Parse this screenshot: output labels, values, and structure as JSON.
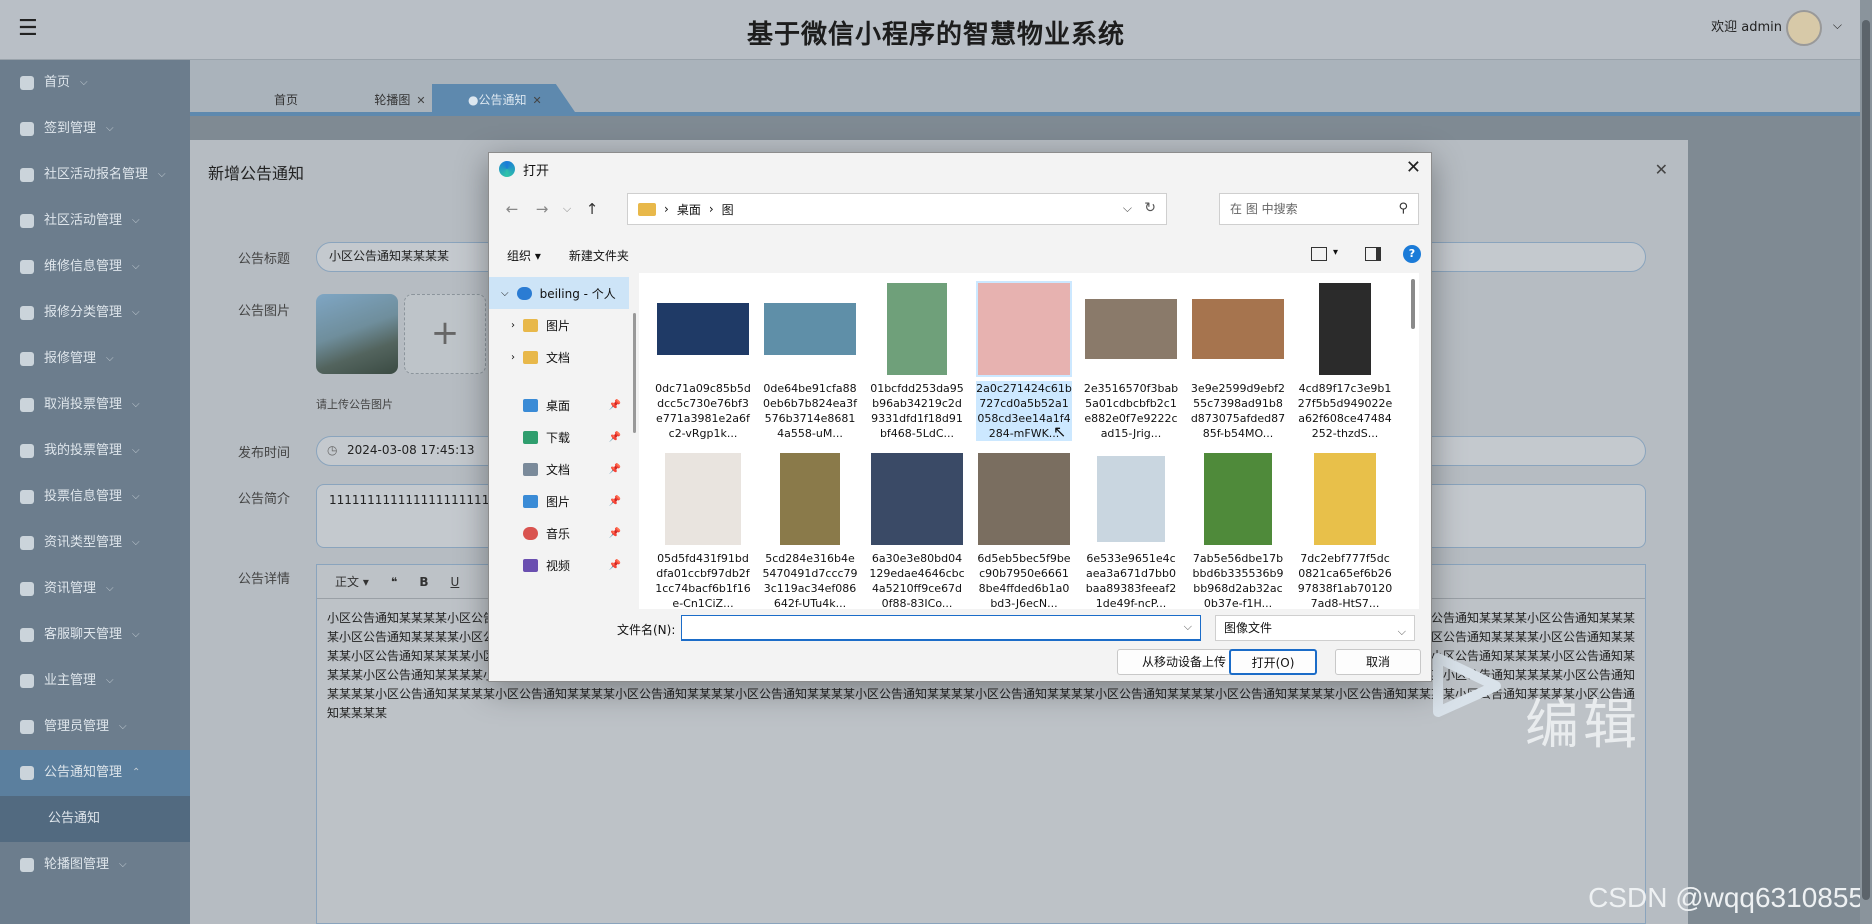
{
  "header": {
    "title": "基于微信小程序的智慧物业系统",
    "welcome": "欢迎 admin"
  },
  "sidebar": {
    "items": [
      {
        "label": "首页"
      },
      {
        "label": "签到管理"
      },
      {
        "label": "社区活动报名管理"
      },
      {
        "label": "社区活动管理"
      },
      {
        "label": "维修信息管理"
      },
      {
        "label": "报修分类管理"
      },
      {
        "label": "报修管理"
      },
      {
        "label": "取消投票管理"
      },
      {
        "label": "我的投票管理"
      },
      {
        "label": "投票信息管理"
      },
      {
        "label": "资讯类型管理"
      },
      {
        "label": "资讯管理"
      },
      {
        "label": "客服聊天管理"
      },
      {
        "label": "业主管理"
      },
      {
        "label": "管理员管理"
      },
      {
        "label": "公告通知管理"
      },
      {
        "label": "公告通知"
      },
      {
        "label": "轮播图管理"
      }
    ]
  },
  "tabs": [
    {
      "label": "首页"
    },
    {
      "label": "轮播图"
    },
    {
      "label": "●公告通知"
    }
  ],
  "dialog": {
    "title": "新增公告通知",
    "labels": {
      "title": "公告标题",
      "image": "公告图片",
      "time": "发布时间",
      "intro": "公告简介",
      "detail": "公告详情"
    },
    "title_value": "小区公告通知某某某某",
    "upload_hint": "请上传公告图片",
    "time_value": "2024-03-08 17:45:13",
    "intro_value": "1111111111111111111111111",
    "editor_toolbar": {
      "format": "正文",
      "quote": "❝",
      "bold": "B",
      "underline": "U"
    },
    "editor_text": "小区公告通知某某某某小区公告通知某某某某小区公告通知某某某某小区公告通知某某某某小区公告通知某某某某小区公告通知某某某某小区公告通知某某某某小区公告通知某某某某小区公告通知某某某某小区公告通知某某某某小区公告通知某某某某小区公告通知某某某某小区公告通知某某某某小区公告通知某某某某小区公告通知某某某某小区公告通知某某某某小区公告通知某某某某小区公告通知某某某某小区公告通知某某某某小区公告通知某某某某小区公告通知某某某某小区公告通知某某某某小区公告通知某某某某小区公告通知某某某某小区公告通知某某某某小区公告通知某某某某小区公告通知某某某某小区公告通知某某某某小区公告通知某某某某小区公告通知某某某某小区公告通知某某某某小区公告通知某某某某小区公告通知某某某某小区公告通知某某某某小区公告通知某某某某小区公告通知某某某某小区公告通知某某某某小区公告通知某某某某小区公告通知某某某某小区公告通知某某某某小区公告通知某某某某小区公告通知某某某某小区公告通知某某某某小区公告通知某某某某小区公告通知某某某某小区公告通知某某某某小区公告通知某某某某小区公告通知某某某某小区公告通知某某某某小区公告通知某某某某小区公告通知某某某某小区公告通知某某某某小区公告通知某某某某小区公告通知某某某某小区公告通知某某某某"
  },
  "watermark": {
    "brand_text": "编辑",
    "csdn": "CSDN @wqq6310855"
  },
  "file_dialog": {
    "title": "打开",
    "path": [
      "桌面",
      "图"
    ],
    "search_placeholder": "在 图 中搜索",
    "organize": "组织 ▾",
    "new_folder": "新建文件夹",
    "tree": [
      {
        "label": "beiling - 个人"
      },
      {
        "label": "图片"
      },
      {
        "label": "文档"
      },
      {
        "label": "桌面"
      },
      {
        "label": "下载"
      },
      {
        "label": "文档"
      },
      {
        "label": "图片"
      },
      {
        "label": "音乐"
      },
      {
        "label": "视频"
      }
    ],
    "files": [
      {
        "name": "0dc71a09c85b5ddcc5c730e76bf3e771a3981e2a6fc2-vRgp1k...",
        "color": "#1f3a66"
      },
      {
        "name": "0de64be91cfa880eb6b7b824ea3f576b3714e86814a558-uM...",
        "color": "#5f8fa8"
      },
      {
        "name": "01bcfdd253da95b96ab34219c2d9331dfd1f18d91bf468-5LdC...",
        "color": "#6fa07a"
      },
      {
        "name": "2a0c271424c61b727cd0a5b52a1058cd3ee14a1f4284-mFWK...",
        "color": "#e7b2b0"
      },
      {
        "name": "2e3516570f3bab5a01cdbcbfb2c1e882e0f7e9222cad15-Jrig...",
        "color": "#8a7a6a"
      },
      {
        "name": "3e9e2599d9ebf255c7398ad91b8d873075afded8785f-b54MO...",
        "color": "#a6744e"
      },
      {
        "name": "4cd89f17c3e9b127f5b5d949022ea62f608ce47484252-thzdS...",
        "color": "#2b2b2b"
      },
      {
        "name": "05d5fd431f91bddfa01ccbf97db2f1cc74bacf6b1f16e-Cn1CiZ...",
        "color": "#e9e4df"
      },
      {
        "name": "5cd284e316b4e5470491d7ccc793c119ac34ef086642f-UTu4k...",
        "color": "#8a7a4a"
      },
      {
        "name": "6a30e3e80bd04129edae4646cbc4a5210ff9ce67d0f88-83ICo...",
        "color": "#3a4a66"
      },
      {
        "name": "6d5eb5bec5f9bec90b7950e66618be4ffded6b1a0bd3-J6ecN...",
        "color": "#7a6e60"
      },
      {
        "name": "6e533e9651e4caea3a671d7bb0baa89383feeaf21de49f-ncP...",
        "color": "#c9d6e0"
      },
      {
        "name": "7ab5e56dbe17bbbd6b335536b9bb968d2ab32ac0b37e-f1H...",
        "color": "#4f8a3a"
      },
      {
        "name": "7dc2ebf777f5dc0821ca65ef6b2697838f1ab701207ad8-HtS7...",
        "color": "#e8c04a"
      }
    ],
    "file_name_label": "文件名(N):",
    "file_type": "图像文件",
    "upload_mobile": "从移动设备上传",
    "open": "打开(O)",
    "cancel": "取消"
  }
}
